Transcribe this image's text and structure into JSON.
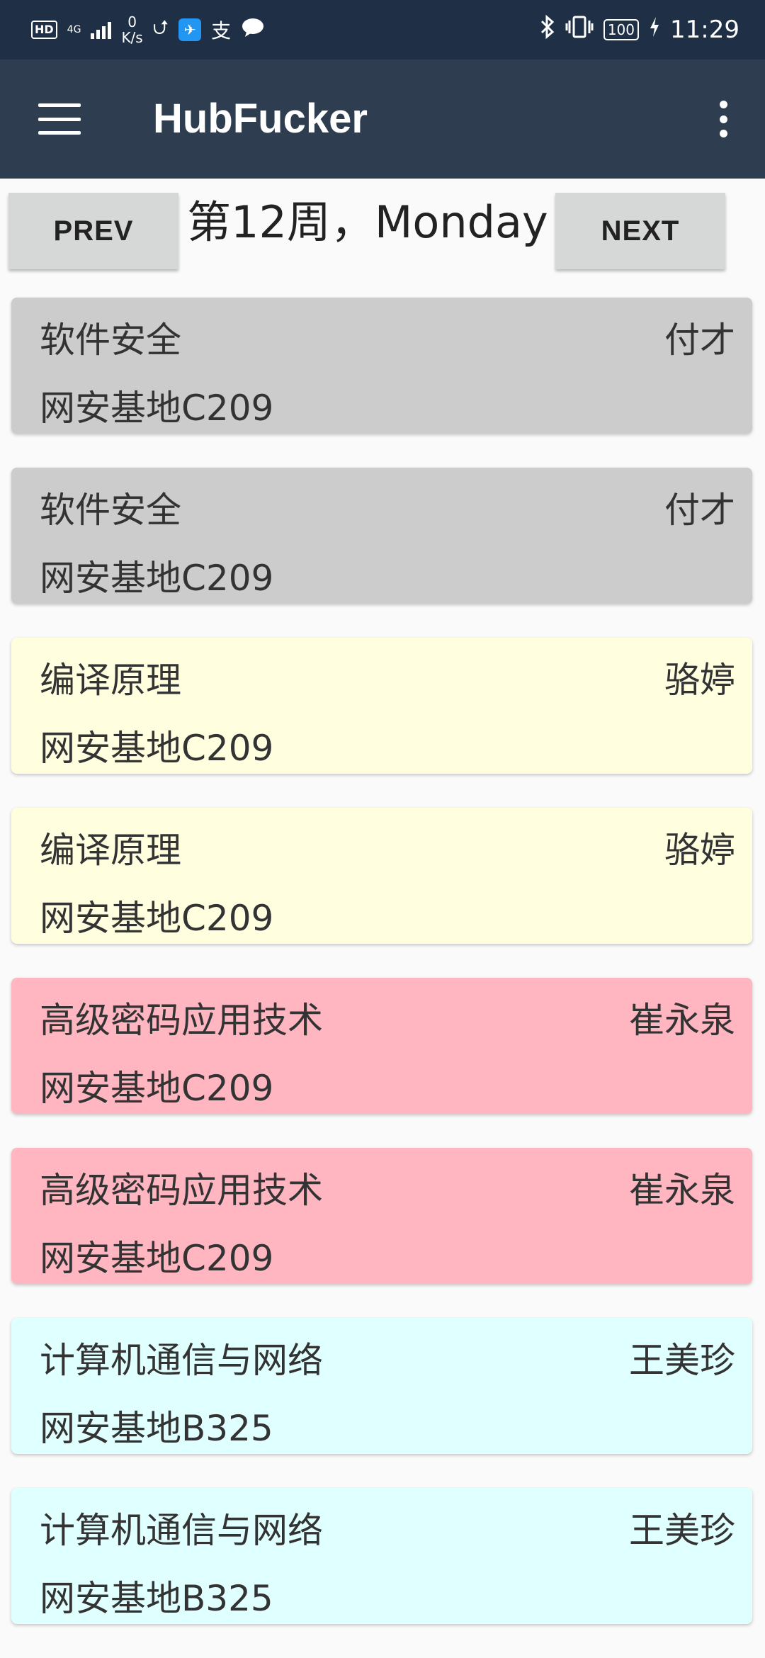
{
  "status_bar": {
    "hd": "HD",
    "network": "4G",
    "speed_value": "0",
    "speed_unit": "K/s",
    "alipay_glyph": "支",
    "battery": "100",
    "time": "11:29",
    "icons": [
      "hd-icon",
      "signal-icon",
      "usb-icon",
      "app-notification-icon",
      "alipay-icon",
      "chat-icon",
      "bluetooth-icon",
      "vibrate-icon",
      "battery-icon",
      "charging-icon"
    ]
  },
  "app_bar": {
    "title": "HubFucker",
    "menu_icon": "hamburger-menu-icon",
    "overflow_icon": "more-vert-icon"
  },
  "nav": {
    "prev_label": "PREV",
    "next_label": "NEXT",
    "week_label": "第12周，Monday"
  },
  "courses": [
    {
      "name": "软件安全",
      "teacher": "付才",
      "room": "网安基地C209",
      "color": "#cccccc"
    },
    {
      "name": "软件安全",
      "teacher": "付才",
      "room": "网安基地C209",
      "color": "#cccccc"
    },
    {
      "name": "编译原理",
      "teacher": "骆婷",
      "room": "网安基地C209",
      "color": "#ffffe0"
    },
    {
      "name": "编译原理",
      "teacher": "骆婷",
      "room": "网安基地C209",
      "color": "#ffffe0"
    },
    {
      "name": "高级密码应用技术",
      "teacher": "崔永泉",
      "room": "网安基地C209",
      "color": "#ffb6c1"
    },
    {
      "name": "高级密码应用技术",
      "teacher": "崔永泉",
      "room": "网安基地C209",
      "color": "#ffb6c1"
    },
    {
      "name": "计算机通信与网络",
      "teacher": "王美珍",
      "room": "网安基地B325",
      "color": "#e0ffff"
    },
    {
      "name": "计算机通信与网络",
      "teacher": "王美珍",
      "room": "网安基地B325",
      "color": "#e0ffff"
    }
  ]
}
